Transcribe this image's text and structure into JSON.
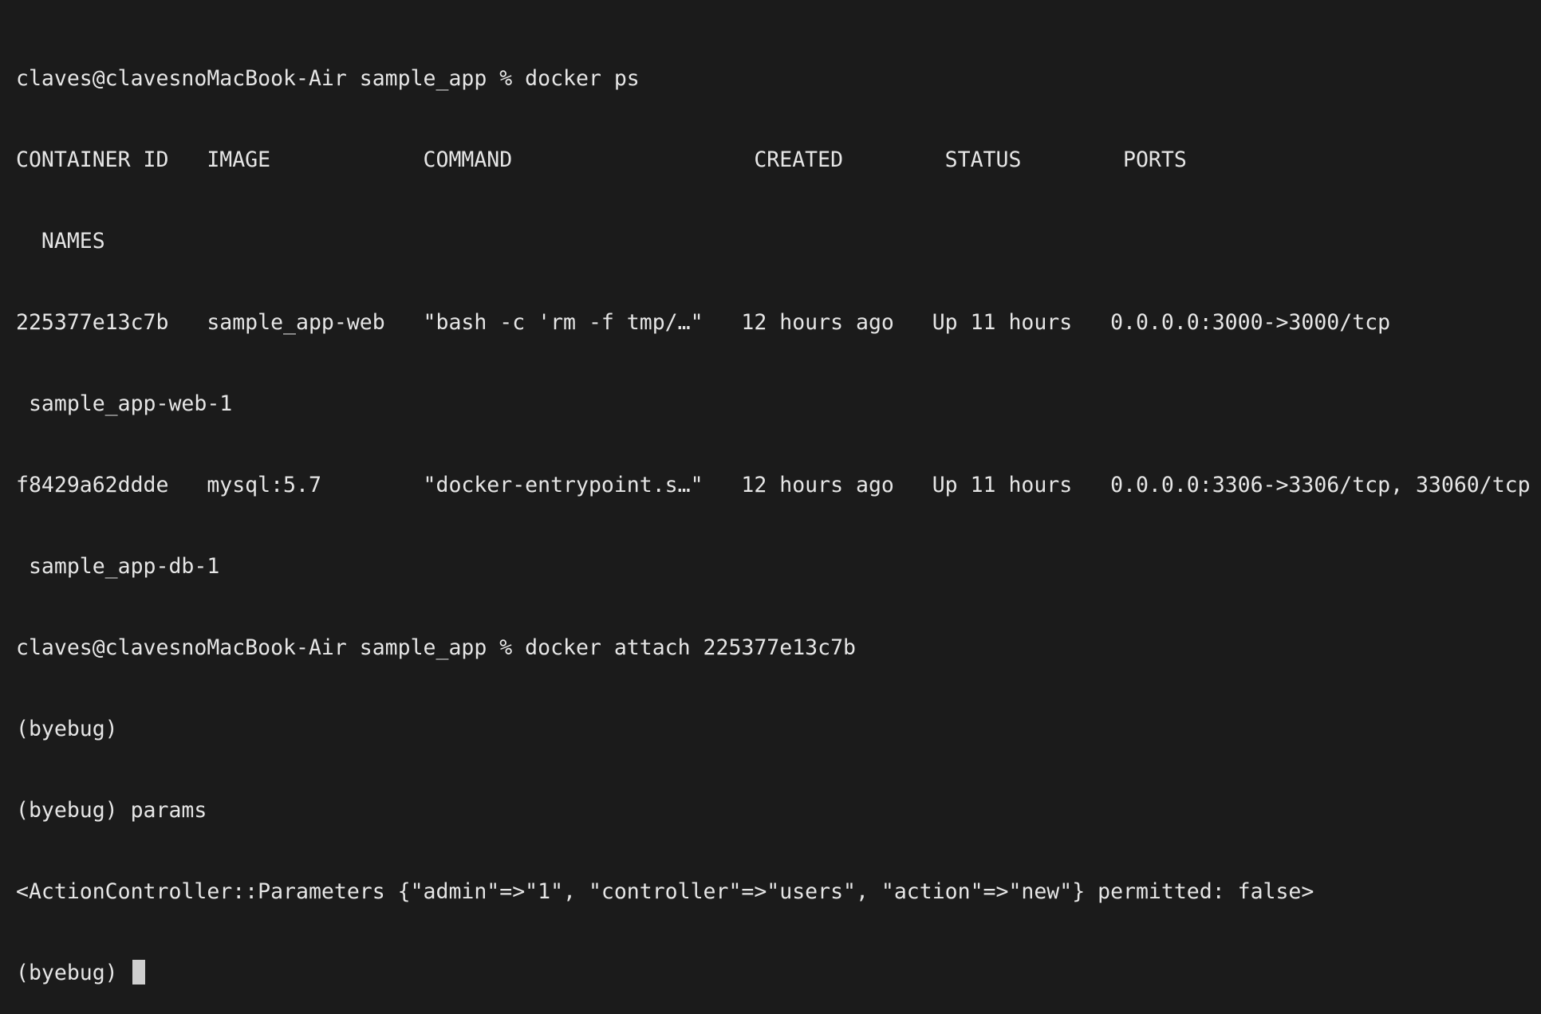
{
  "terminal": {
    "lines": [
      "claves@clavesnoMacBook-Air sample_app % docker ps",
      "CONTAINER ID   IMAGE            COMMAND                   CREATED        STATUS        PORTS",
      "  NAMES",
      "225377e13c7b   sample_app-web   \"bash -c 'rm -f tmp/…\"   12 hours ago   Up 11 hours   0.0.0.0:3000->3000/tcp",
      " sample_app-web-1",
      "f8429a62ddde   mysql:5.7        \"docker-entrypoint.s…\"   12 hours ago   Up 11 hours   0.0.0.0:3306->3306/tcp, 33060/tcp",
      " sample_app-db-1",
      "claves@clavesnoMacBook-Air sample_app % docker attach 225377e13c7b",
      "(byebug)",
      "(byebug) params",
      "<ActionController::Parameters {\"admin\"=>\"1\", \"controller\"=>\"users\", \"action\"=>\"new\"} permitted: false>"
    ],
    "prompt": "(byebug) "
  }
}
